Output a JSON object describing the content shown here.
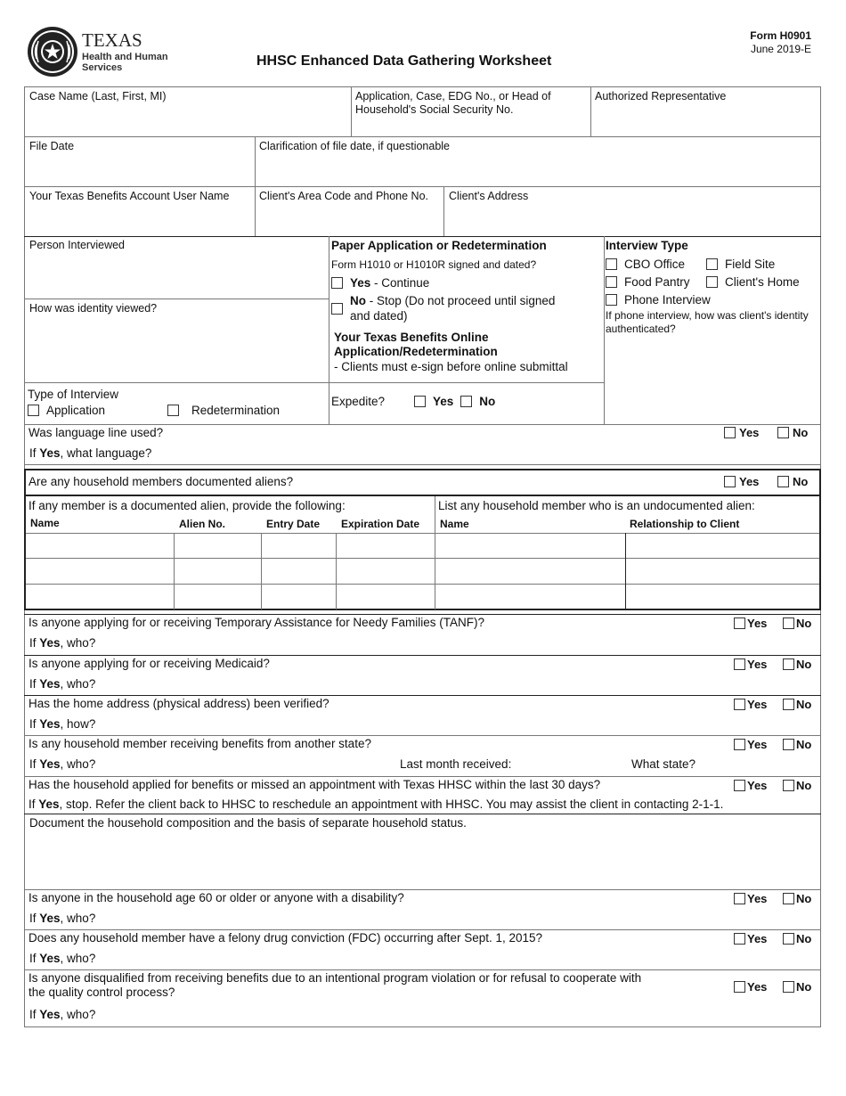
{
  "header": {
    "logo_line1": "TEXAS",
    "logo_line2": "Health and Human",
    "logo_line3": "Services",
    "title": "HHSC Enhanced Data Gathering Worksheet",
    "form_number": "Form H0901",
    "form_date": "June 2019-E"
  },
  "section1": {
    "case_name": "Case Name (Last, First, MI)",
    "application_no_line1": "Application, Case, EDG No., or Head of",
    "application_no_line2": "Household's Social Security No.",
    "authorized_rep": "Authorized Representative",
    "file_date": "File Date",
    "clarification": "Clarification of file date, if questionable",
    "ytb_user": "Your Texas Benefits Account User Name",
    "phone": "Client's Area Code and Phone No.",
    "address": "Client's Address"
  },
  "section2": {
    "person_interviewed": "Person Interviewed",
    "identity_viewed": "How was identity viewed?",
    "paper_app_title": "Paper Application or Redetermination",
    "form_signed": "Form H1010 or H1010R signed and dated?",
    "yes_bold": "Yes",
    "yes_continue": " - Continue",
    "no_bold": "No",
    "no_stop_line1": " - Stop (Do not proceed until signed",
    "no_stop_line2": "and dated)",
    "ytb_online_line1": "Your Texas Benefits Online",
    "ytb_online_line2": "Application/Redetermination",
    "esign_note": " - Clients must e-sign before online submittal",
    "interview_type_title": "Interview Type",
    "interview_options": [
      "CBO Office",
      "Field Site",
      "Food Pantry",
      "Client's Home",
      "Phone Interview"
    ],
    "phone_auth_line1": "If phone interview, how was client's identity",
    "phone_auth_line2": "authenticated?",
    "type_of_interview": "Type of Interview",
    "type_application": "Application",
    "type_redetermination": "Redetermination",
    "expedite": "Expedite?",
    "expedite_yes": "Yes",
    "expedite_no": "No"
  },
  "labels": {
    "yes": "Yes",
    "no": "No",
    "if": "If ",
    "yes_bold": "Yes"
  },
  "language": {
    "question": "Was language line used?",
    "followup": ", what language?"
  },
  "aliens": {
    "question": "Are any household members documented aliens?",
    "documented_intro": "If any member is a documented alien, provide the following:",
    "undocumented_intro": "List any household member who is an undocumented alien:",
    "documented_columns": [
      "Name",
      "Alien No.",
      "Entry Date",
      "Expiration Date"
    ],
    "undocumented_columns": [
      "Name",
      "Relationship to Client"
    ],
    "rows": [
      {
        "name": "",
        "alien_no": "",
        "entry_date": "",
        "expiration_date": "",
        "u_name": "",
        "relationship": ""
      },
      {
        "name": "",
        "alien_no": "",
        "entry_date": "",
        "expiration_date": "",
        "u_name": "",
        "relationship": ""
      },
      {
        "name": "",
        "alien_no": "",
        "entry_date": "",
        "expiration_date": "",
        "u_name": "",
        "relationship": ""
      }
    ]
  },
  "questions": {
    "tanf": "Is anyone applying for or receiving Temporary Assistance for Needy Families (TANF)?",
    "tanf_follow": ", who?",
    "medicaid": "Is anyone applying for or receiving Medicaid?",
    "medicaid_follow": ", who?",
    "address_verified": "Has the home address (physical address) been verified?",
    "address_follow": ", how?",
    "other_state": "Is any household member receiving benefits from another state?",
    "other_state_follow": ", who?",
    "last_month": "Last month received:",
    "what_state": "What state?",
    "applied_30": "Has the household applied for benefits or missed an appointment with Texas HHSC within the last 30 days?",
    "applied_30_follow": ", stop. Refer the client back to HHSC to reschedule an appointment with HHSC. You may assist the client in contacting 2-1-1.",
    "household_comp": "Document the household composition and the basis of separate household status.",
    "age60": "Is anyone in the household age 60 or older or anyone with a disability?",
    "age60_follow": ", who?",
    "fdc": "Does any household member have a felony drug conviction (FDC) occurring after Sept. 1, 2015?",
    "fdc_follow": ", who?",
    "disq_line1": "Is anyone disqualified from receiving benefits due to an intentional program violation or for refusal to cooperate with",
    "disq_line2": "the quality control process?",
    "disq_follow": ", who?"
  }
}
